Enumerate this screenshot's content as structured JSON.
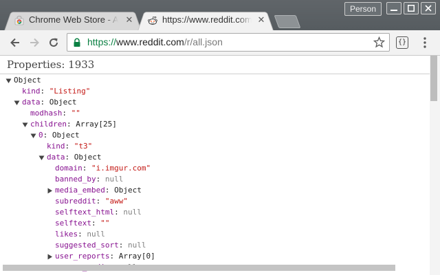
{
  "window": {
    "profile_label": "Person",
    "colors": {
      "titlebar": "#5d6468",
      "tab_active": "#f2f2f2",
      "tab_inactive": "#d8d8d8"
    }
  },
  "tabs": [
    {
      "title": "Chrome Web Store - Apps",
      "icon": "chrome-web-store-icon",
      "active": false
    },
    {
      "title": "https://www.reddit.com/r/all.json",
      "icon": "reddit-alien-icon",
      "active": true
    }
  ],
  "toolbar": {
    "url_scheme": "https://",
    "url_host": "www.reddit.com",
    "url_path": "/r/all.json",
    "extension_label": "{}"
  },
  "viewer": {
    "properties_label": "Properties: 1933",
    "colors": {
      "key": "#881391",
      "string": "#c41a16",
      "null": "#808080"
    },
    "rows": [
      {
        "indent": 0,
        "toggle": "expanded",
        "key": "",
        "value": "Object",
        "type": "o"
      },
      {
        "indent": 1,
        "toggle": "",
        "key": "kind",
        "value": "\"Listing\"",
        "type": "s"
      },
      {
        "indent": 1,
        "toggle": "expanded",
        "key": "data",
        "value": "Object",
        "type": "o"
      },
      {
        "indent": 2,
        "toggle": "",
        "key": "modhash",
        "value": "\"\"",
        "type": "s"
      },
      {
        "indent": 2,
        "toggle": "expanded",
        "key": "children",
        "value": "Array[25]",
        "type": "o"
      },
      {
        "indent": 3,
        "toggle": "expanded",
        "key": "0",
        "value": "Object",
        "type": "o"
      },
      {
        "indent": 4,
        "toggle": "",
        "key": "kind",
        "value": "\"t3\"",
        "type": "s"
      },
      {
        "indent": 4,
        "toggle": "expanded",
        "key": "data",
        "value": "Object",
        "type": "o"
      },
      {
        "indent": 5,
        "toggle": "",
        "key": "domain",
        "value": "\"i.imgur.com\"",
        "type": "s"
      },
      {
        "indent": 5,
        "toggle": "",
        "key": "banned_by",
        "value": "null",
        "type": "n"
      },
      {
        "indent": 5,
        "toggle": "collapsed",
        "key": "media_embed",
        "value": "Object",
        "type": "o"
      },
      {
        "indent": 5,
        "toggle": "",
        "key": "subreddit",
        "value": "\"aww\"",
        "type": "s"
      },
      {
        "indent": 5,
        "toggle": "",
        "key": "selftext_html",
        "value": "null",
        "type": "n"
      },
      {
        "indent": 5,
        "toggle": "",
        "key": "selftext",
        "value": "\"\"",
        "type": "s"
      },
      {
        "indent": 5,
        "toggle": "",
        "key": "likes",
        "value": "null",
        "type": "n"
      },
      {
        "indent": 5,
        "toggle": "",
        "key": "suggested_sort",
        "value": "null",
        "type": "n"
      },
      {
        "indent": 5,
        "toggle": "collapsed",
        "key": "user_reports",
        "value": "Array[0]",
        "type": "o"
      },
      {
        "indent": 5,
        "toggle": "",
        "key": "secure_media",
        "value": "null",
        "type": "n"
      }
    ]
  }
}
